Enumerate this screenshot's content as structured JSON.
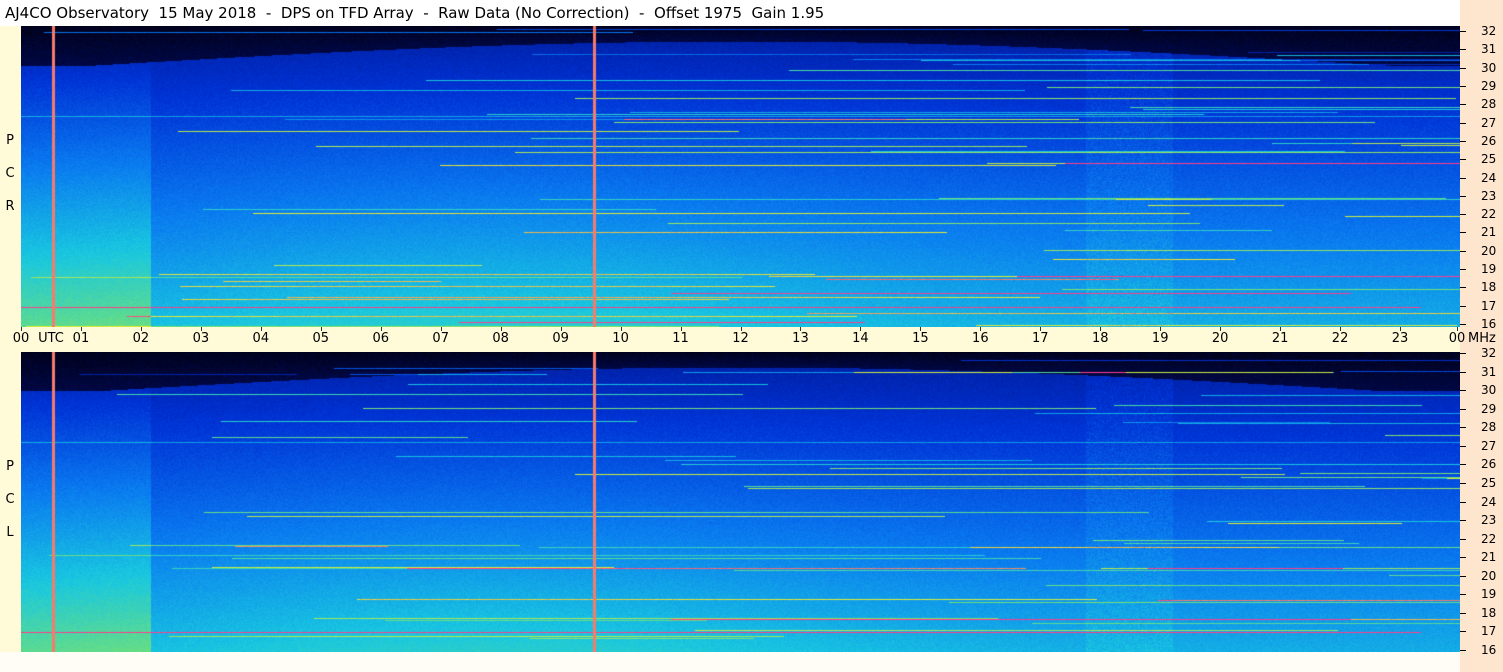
{
  "title": "AJ4CO Observatory  15 May 2018  -  DPS on TFD Array  -  Raw Data (No Correction)  -  Offset 1975  Gain 1.95",
  "panels": {
    "top_polarization": [
      "R",
      "C",
      "P"
    ],
    "bottom_polarization": [
      "L",
      "C",
      "P"
    ]
  },
  "time_axis": {
    "labels": [
      "00",
      "UTC",
      "01",
      "02",
      "03",
      "04",
      "05",
      "06",
      "07",
      "08",
      "09",
      "10",
      "11",
      "12",
      "13",
      "14",
      "15",
      "16",
      "17",
      "18",
      "19",
      "20",
      "21",
      "22",
      "23",
      "00"
    ],
    "unit_label": "MHz"
  },
  "frequency_axis": {
    "labels": [
      "32",
      "31",
      "30",
      "29",
      "28",
      "27",
      "26",
      "25",
      "24",
      "23",
      "22",
      "21",
      "20",
      "19",
      "18",
      "17",
      "16"
    ],
    "range_mhz": [
      16,
      32
    ]
  },
  "colormap": [
    "#000010",
    "#00107a",
    "#0033d6",
    "#0a7cf0",
    "#19c8e0",
    "#6fe07a",
    "#e6f032",
    "#ff3c8c"
  ]
}
